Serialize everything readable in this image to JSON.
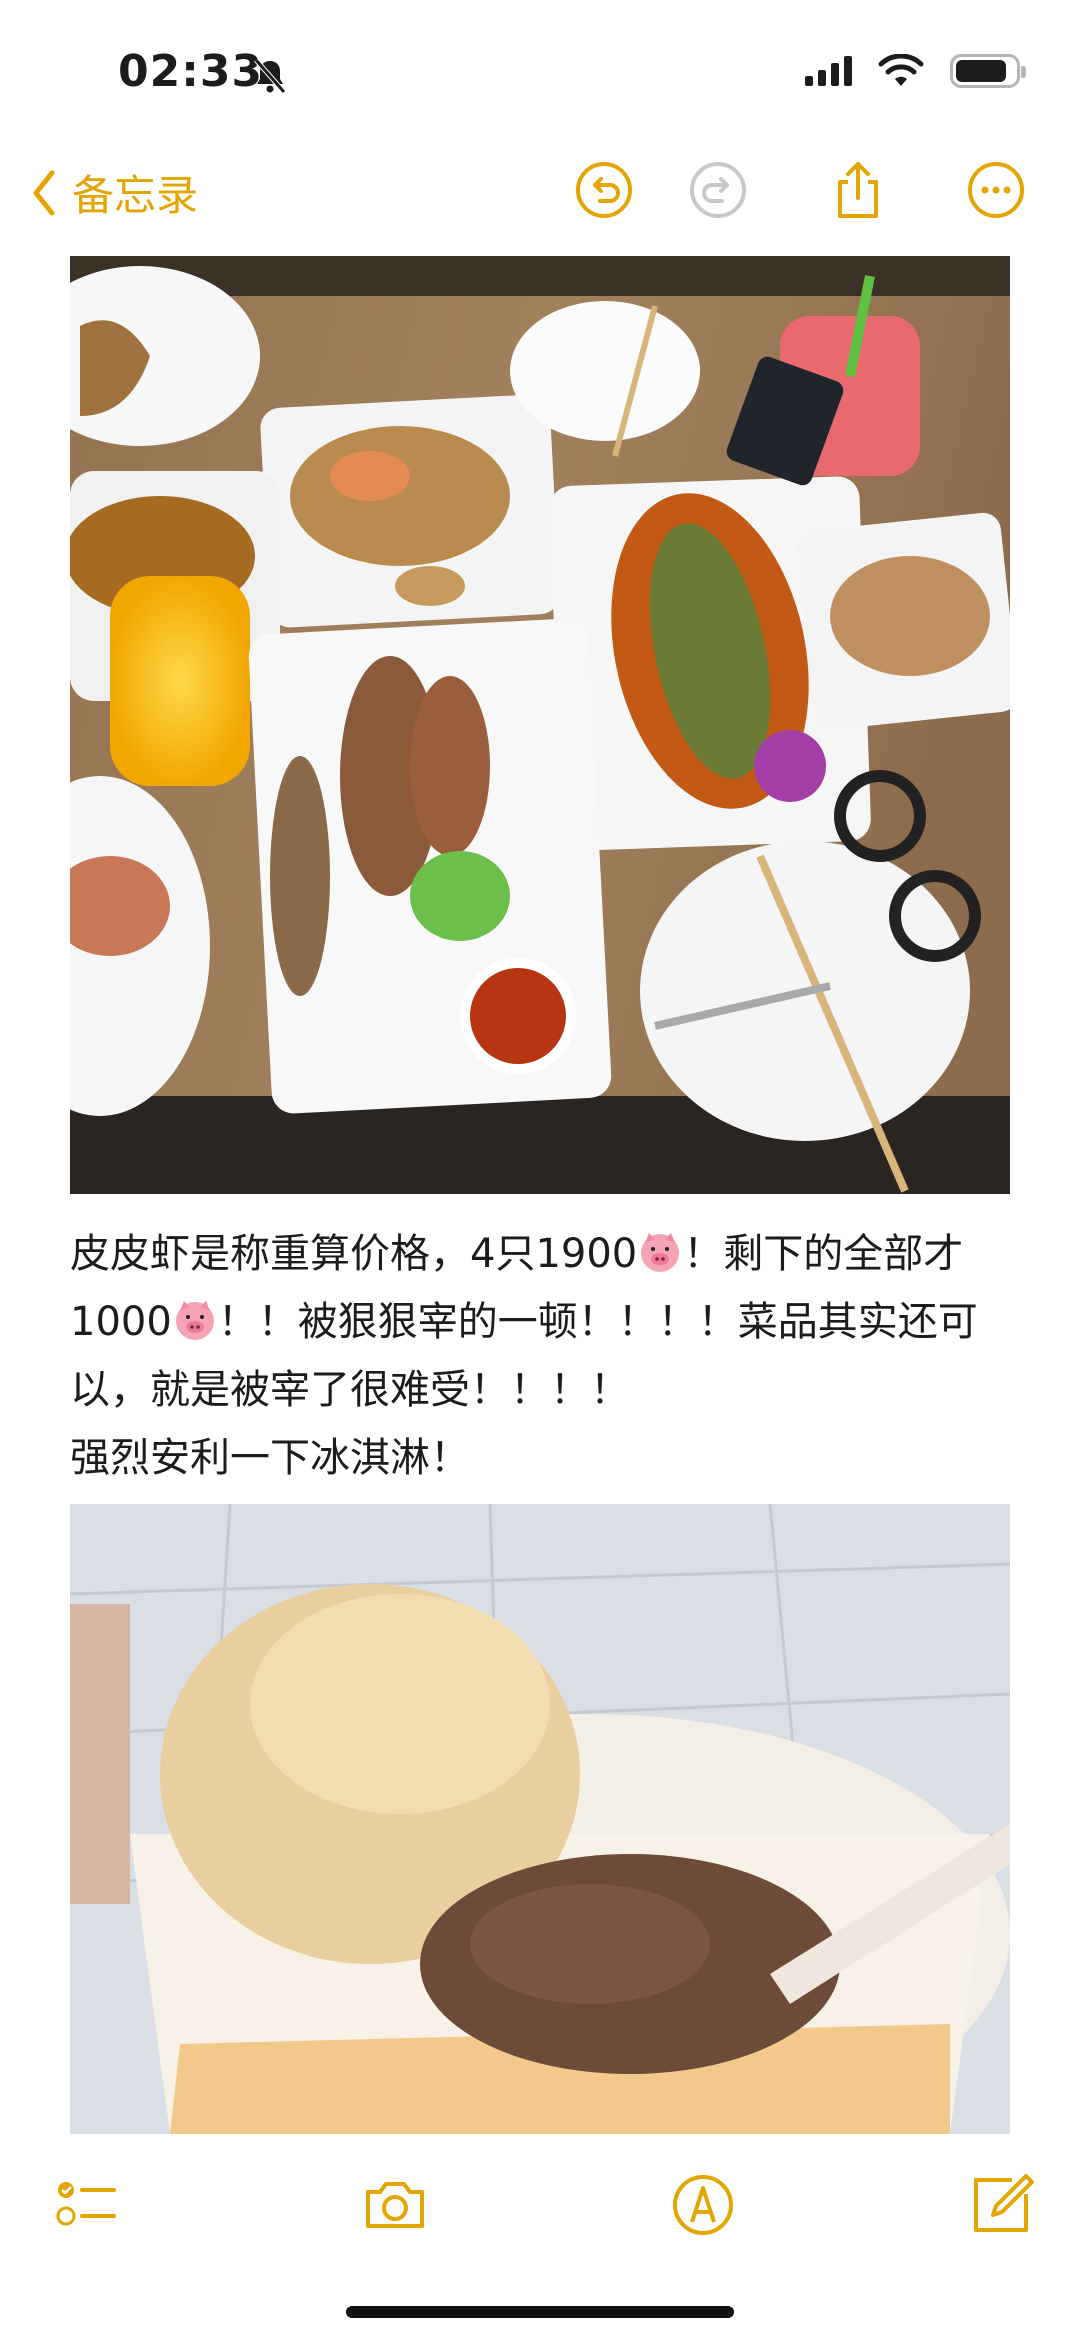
{
  "status": {
    "time": "02:33",
    "icons": [
      "bell-slash-icon",
      "cellular-signal-icon",
      "wifi-icon",
      "battery-icon"
    ],
    "battery_level": 0.78
  },
  "nav": {
    "back_label": "备忘录",
    "icons": [
      "chevron-left-icon",
      "undo-icon",
      "redo-icon",
      "share-icon",
      "more-icon"
    ],
    "accent": "#e3a502"
  },
  "note": {
    "paragraphs": [
      {
        "before_pig1": "皮皮虾是称重算价格，4只1900",
        "after_pig1": "！剩下的全部才1000",
        "after_pig2": "！！被狠狠宰的一顿！！！！菜品其实还可以，就是被宰了很难受！！！！"
      },
      {
        "text": "强烈安利一下冰淇淋！"
      }
    ],
    "images": [
      "thai-seafood-dinner-photo",
      "ice-cream-cup-photo"
    ]
  },
  "toolbar": {
    "icons": [
      "checklist-icon",
      "camera-icon",
      "markup-pen-icon",
      "compose-icon"
    ]
  }
}
